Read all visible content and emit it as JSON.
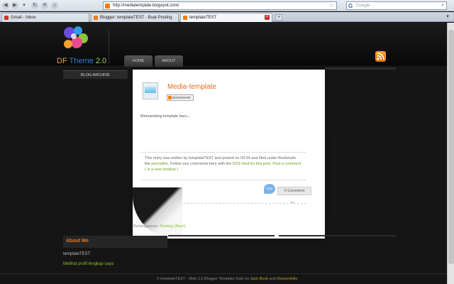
{
  "browser": {
    "url": "http://mediatemplate.blogspot.com/",
    "search_placeholder": "Google",
    "tabs": [
      {
        "label": "Gmail - Inbox",
        "favicon_color": "#d93025"
      },
      {
        "label": "Blogger: templateTEST - Buat Posting",
        "favicon_color": "#f57d00"
      },
      {
        "label": "templateTEST",
        "favicon_color": "#f57d00"
      }
    ]
  },
  "site": {
    "logo": {
      "df": "DF",
      "theme": "Theme",
      "version": "2.0"
    },
    "nav": [
      "HOME",
      "ABOUT"
    ],
    "sidebar_heading": "BLOG ARCHIVE"
  },
  "post": {
    "title": "Media-template",
    "bookmark_label": "BOOKMARK",
    "body": "Memandang template baru...",
    "info": {
      "p1": "This entry was written by templateTEST and posted on 04:34 and filed under Bookmark the",
      "permalink": "permalink",
      "p2": ". Follow any comments here with the",
      "rss": "RSS feed for this post",
      "p3": ".",
      "post_comment": "Post a comment ( in a new window )"
    },
    "comment_icon": "RSS",
    "comment_count": "0 Comment"
  },
  "subscribe": {
    "prefix": "Berlangganan:",
    "link": "Posting (Atom)"
  },
  "about": {
    "heading": "About Me",
    "name": "templateTEST",
    "profile_link": "Melihat profil lengkap saya"
  },
  "footer": {
    "prefix": "© templateTEST - Web 2.0 Blogger Template Dark by",
    "author1": "Jack Book",
    "and": "and",
    "author2": "Dezinerfolio"
  },
  "colors": {
    "accent_orange": "#e66a1c",
    "link_green": "#8fbf2e",
    "bg_dark": "#111111"
  }
}
